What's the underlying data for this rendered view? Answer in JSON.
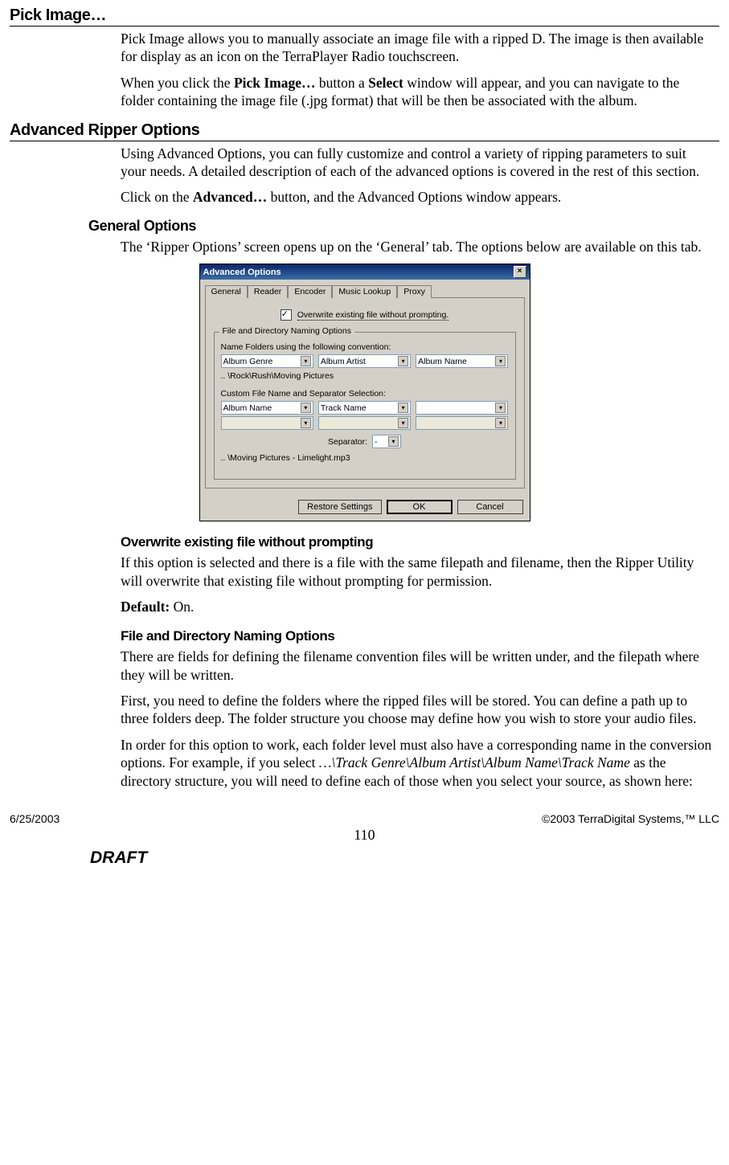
{
  "sections": {
    "pick_image": {
      "title": "Pick Image…",
      "p1": "Pick Image allows you to manually associate an image file with a ripped D.  The image is then available for display as an icon on the TerraPlayer Radio touchscreen.",
      "p2_a": "When you click the ",
      "p2_b": "Pick Image…",
      "p2_c": " button a ",
      "p2_d": "Select",
      "p2_e": " window will appear, and you can navigate to the folder containing the image file (.jpg format) that will be then be associated with the album."
    },
    "advanced": {
      "title": "Advanced Ripper Options",
      "p1": "Using Advanced Options, you can fully customize and control a variety of ripping parameters to suit your needs.  A detailed description of each of the advanced options is covered in the rest of this section.",
      "p2_a": "Click on the ",
      "p2_b": "Advanced…",
      "p2_c": " button, and the Advanced Options window appears."
    },
    "general": {
      "title": "General Options",
      "p1": "The ‘Ripper Options’ screen opens up on the ‘General’ tab.  The options below are available on this tab."
    },
    "overwrite": {
      "title": "Overwrite existing file without prompting",
      "p1": "If this option is selected and there is a file with the same filepath and filename, then the Ripper Utility will overwrite that existing file without prompting for permission.",
      "p2_a": "Default:",
      "p2_b": " On."
    },
    "naming": {
      "title": "File and Directory Naming Options",
      "p1": "There are fields for defining the filename convention files will be written under, and the filepath where they will be written.",
      "p2": "First, you need to define the folders where the ripped files will be stored.  You can define a path up to three folders deep.  The folder structure you choose may define how you wish to store your audio files.",
      "p3_a": "In order for this option to work, each folder level must also have a corresponding name in the conversion options.   For example, if you select ",
      "p3_b": "…\\Track Genre\\Album Artist\\Album Name\\Track Name",
      "p3_c": " as the directory structure, you will need to define each of those when you select your source, as shown here:"
    }
  },
  "dialog": {
    "title": "Advanced Options",
    "tabs": [
      "General",
      "Reader",
      "Encoder",
      "Music Lookup",
      "Proxy"
    ],
    "checkbox_label": "Overwrite existing file without prompting.",
    "fieldset_legend": "File and Directory Naming Options",
    "folder_label": "Name Folders using the following convention:",
    "folder_selects": [
      "Album Genre",
      "Album Artist",
      "Album Name"
    ],
    "folder_path": ".. \\Rock\\Rush\\Moving Pictures",
    "custom_label": "Custom File Name and Separator Selection:",
    "file_selects_row1": [
      "Album Name",
      "Track Name",
      ""
    ],
    "file_selects_row2": [
      "",
      "",
      ""
    ],
    "separator_label": "Separator:",
    "separator_value": " - ",
    "file_path": ".. \\Moving Pictures - Limelight.mp3",
    "buttons": {
      "restore": "Restore Settings",
      "ok": "OK",
      "cancel": "Cancel"
    }
  },
  "footer": {
    "left": "6/25/2003",
    "right": "©2003 TerraDigital Systems,™ LLC",
    "page": "110",
    "draft": "DRAFT"
  }
}
